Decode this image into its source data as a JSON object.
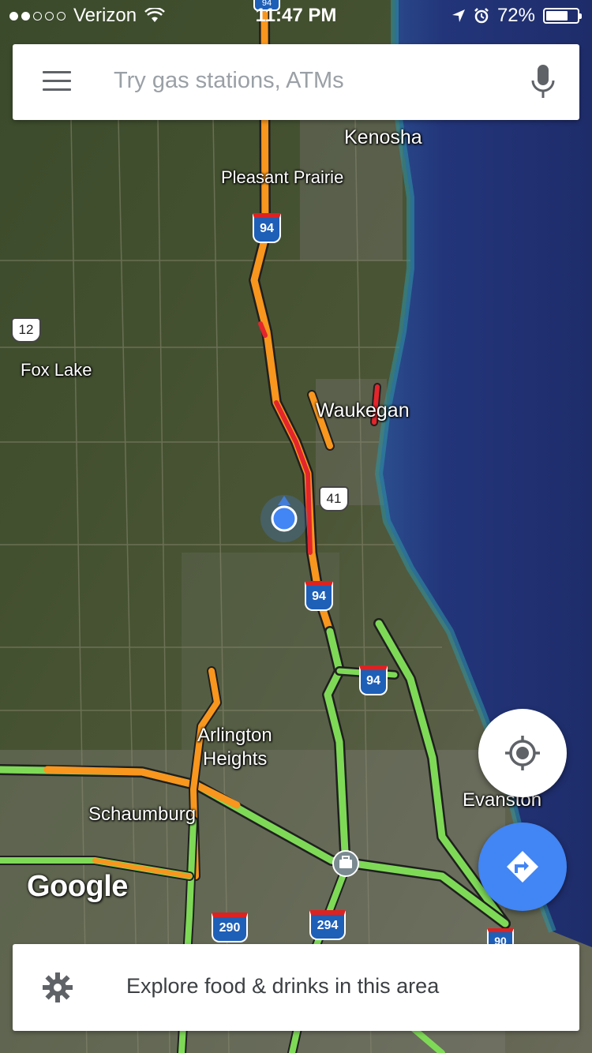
{
  "status_bar": {
    "signal_dots_filled": 2,
    "signal_dots_total": 5,
    "carrier": "Verizon",
    "time": "11:47 PM",
    "battery_percent": "72%",
    "battery_level": 0.72
  },
  "search": {
    "placeholder": "Try gas stations, ATMs",
    "menu_icon": "hamburger-menu-icon",
    "voice_icon": "microphone-icon"
  },
  "map": {
    "places": [
      "Kenosha",
      "Pleasant Prairie",
      "Fox Lake",
      "Waukegan",
      "Arlington Heights",
      "Schaumburg",
      "Evanston"
    ],
    "arlington": [
      "Arlington",
      "Heights"
    ],
    "highway_shields": {
      "i94_a": "94",
      "i94_b": "94",
      "i94_c": "94",
      "i94_top": "94",
      "us12": "12",
      "us41": "41",
      "i290": "290",
      "i294": "294",
      "i90": "90"
    },
    "attribution": "Google",
    "traffic_colors": {
      "fast": "#7ed957",
      "moderate": "#f8961d",
      "slow": "#e4262c"
    },
    "water_color": "#23357a",
    "location_color": "#4285f4"
  },
  "controls": {
    "my_location_icon": "crosshair-icon",
    "directions_icon": "directions-arrow-icon"
  },
  "explore": {
    "label": "Explore food & drinks in this area",
    "icon": "gear-icon"
  }
}
